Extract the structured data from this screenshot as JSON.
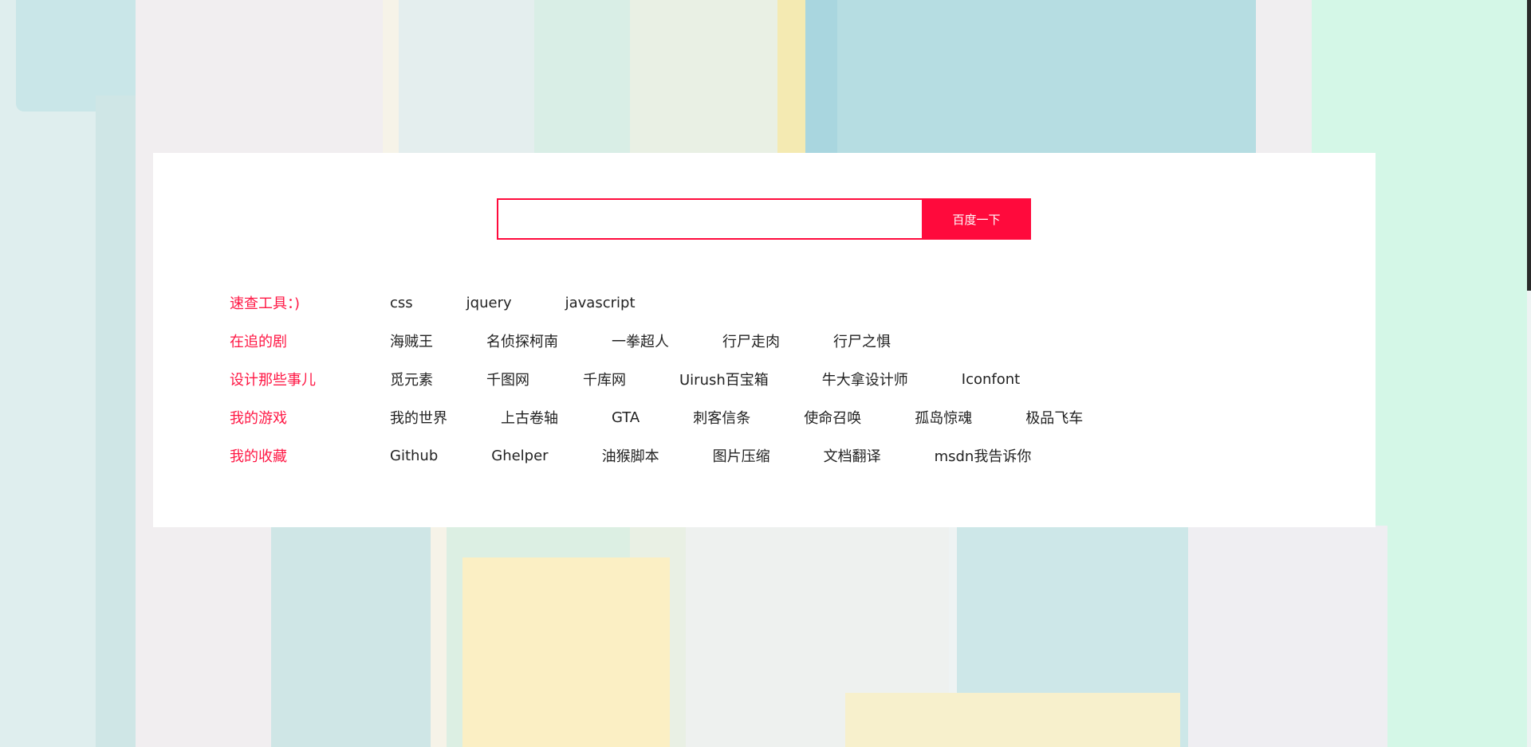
{
  "search": {
    "value": "",
    "placeholder": "",
    "button_label": "百度一下"
  },
  "rows": [
    {
      "label": "速查工具：)",
      "links": [
        "css",
        "jquery",
        "javascript"
      ]
    },
    {
      "label": "在追的剧",
      "links": [
        "海贼王",
        "名侦探柯南",
        "一拳超人",
        "行尸走肉",
        "行尸之惧"
      ]
    },
    {
      "label": "设计那些事儿",
      "links": [
        "觅元素",
        "千图网",
        "千库网",
        "Uirush百宝箱",
        "牛大拿设计师",
        "Iconfont"
      ]
    },
    {
      "label": "我的游戏",
      "links": [
        "我的世界",
        "上古卷轴",
        "GTA",
        "刺客信条",
        "使命召唤",
        "孤岛惊魂",
        "极品飞车"
      ]
    },
    {
      "label": "我的收藏",
      "links": [
        "Github",
        "Ghelper",
        "油猴脚本",
        "图片压缩",
        "文档翻译",
        "msdn我告诉你"
      ]
    }
  ],
  "colors": {
    "accent": "#ff0a3c",
    "label": "#ff1744",
    "link": "#222222",
    "panel": "#ffffff"
  }
}
